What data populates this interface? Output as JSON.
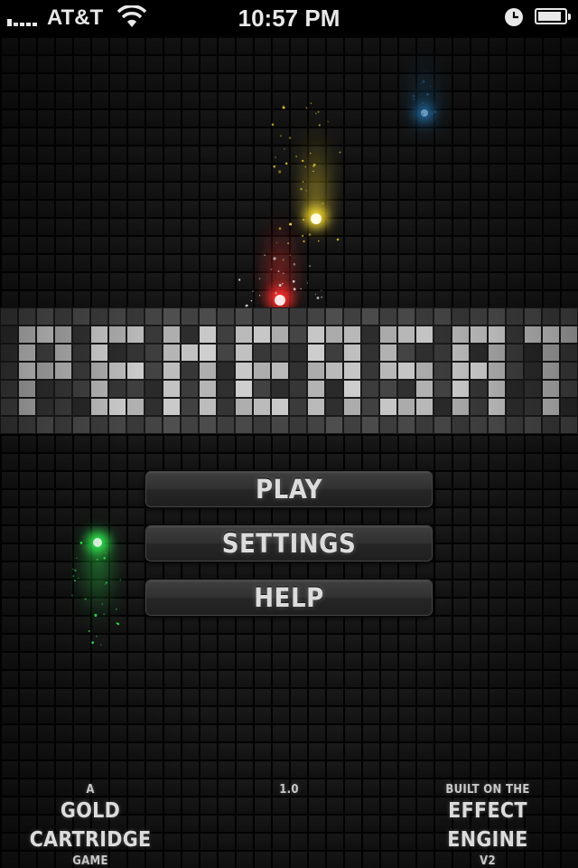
{
  "status_bar": {
    "carrier": "AT&T",
    "time": "10:57 PM",
    "signal_bars_lit": 1,
    "battery_level": 0.9
  },
  "menu": {
    "items": [
      {
        "label": "PLAY"
      },
      {
        "label": "SETTINGS"
      },
      {
        "label": "HELP"
      }
    ]
  },
  "footer": {
    "credit_left": {
      "line1": "A",
      "line2": "GOLD CARTRIDGE",
      "line3": "GAME"
    },
    "version": "1.0",
    "credit_right": {
      "line1": "BUILT ON THE",
      "line2": "EFFECT ENGINE",
      "line3": "V2"
    }
  },
  "colors": {
    "red_comet": "#ff2a2a",
    "yellow_comet": "#ffe233",
    "blue_comet": "#2a8fd8",
    "green_comet": "#33ff55"
  }
}
